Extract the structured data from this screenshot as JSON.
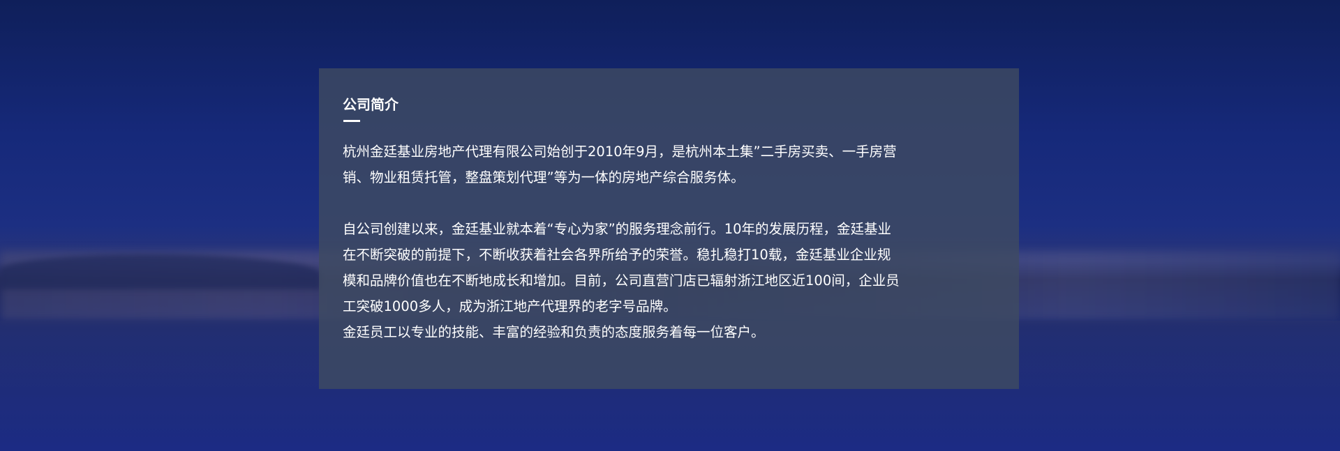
{
  "section": {
    "title": "公司简介",
    "paragraphs": [
      [
        "杭州金廷基业房地产代理有限公司始创于2010年9月，是杭州本土集”二手房买卖、一手房营",
        "销、物业租赁托管，整盘策划代理”等为一体的房地产综合服务体。"
      ],
      [
        "自公司创建以来，金廷基业就本着“专心为家”的服务理念前行。10年的发展历程，金廷基业",
        "在不断突破的前提下，不断收获着社会各界所给予的荣誉。稳扎稳打10载，金廷基业企业规",
        "模和品牌价值也在不断地成长和增加。目前，公司直营门店已辐射浙江地区近100间，企业员",
        "工突破1000多人，成为浙江地产代理界的老字号品牌。"
      ],
      [
        "金廷员工以专业的技能、丰富的经验和负责的态度服务着每一位客户。"
      ]
    ]
  }
}
